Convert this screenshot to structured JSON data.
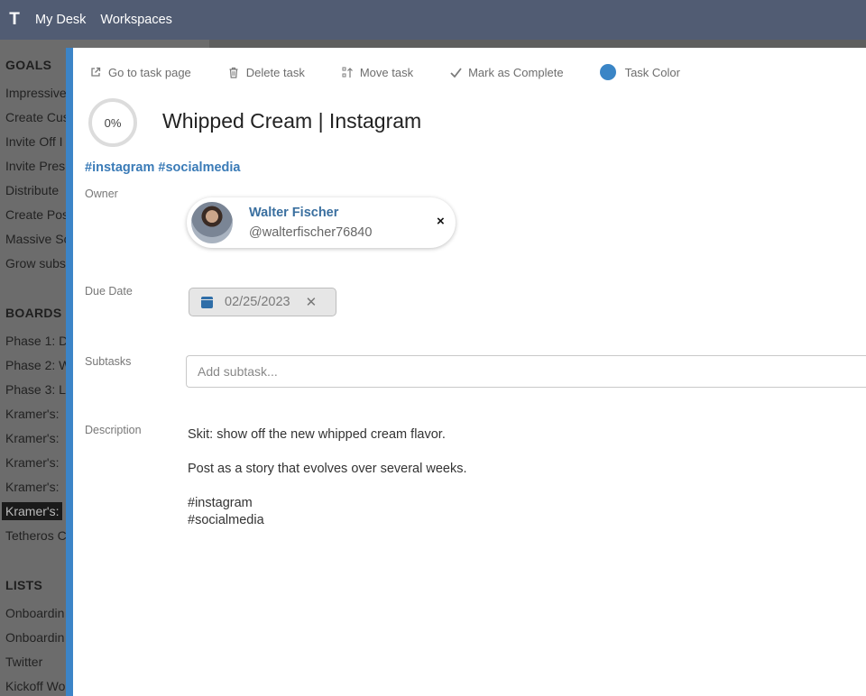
{
  "topbar": {
    "logo": "T",
    "nav": [
      "My Desk",
      "Workspaces"
    ]
  },
  "sidebar": {
    "goals_title": "GOALS",
    "goals": [
      "Impressive",
      "Create Cus",
      "Invite Off I",
      "Invite Pres",
      "Distribute",
      "Create Pos",
      "Massive Sc",
      "Grow subs"
    ],
    "boards_title": "BOARDS",
    "boards": [
      "Phase 1: D",
      "Phase 2: W",
      "Phase 3: L",
      "Kramer's:",
      "Kramer's:",
      "Kramer's:",
      "Kramer's:",
      "Kramer's:",
      "Tetheros C"
    ],
    "active_board_index": 7,
    "lists_title": "LISTS",
    "lists": [
      "Onboardin",
      "Onboardin",
      "Twitter",
      "Kickoff Wo"
    ]
  },
  "toolbar": {
    "go_to_task": "Go to task page",
    "delete": "Delete task",
    "move": "Move task",
    "complete": "Mark as Complete",
    "color": "Task Color",
    "task_color": "#3a85c6"
  },
  "task": {
    "progress": "0%",
    "title": "Whipped Cream | Instagram",
    "tags": "#instagram #socialmedia"
  },
  "owner": {
    "label": "Owner",
    "name": "Walter Fischer",
    "handle": "@walterfischer76840",
    "remove": "×"
  },
  "due": {
    "label": "Due Date",
    "value": "02/25/2023",
    "clear": "✕"
  },
  "subtasks": {
    "label": "Subtasks",
    "placeholder": "Add subtask..."
  },
  "description": {
    "label": "Description",
    "line1": "Skit: show off the new whipped cream flavor.",
    "line2": "Post as a story that evolves over several weeks.",
    "line3": "#instagram",
    "line4": "#socialmedia"
  }
}
